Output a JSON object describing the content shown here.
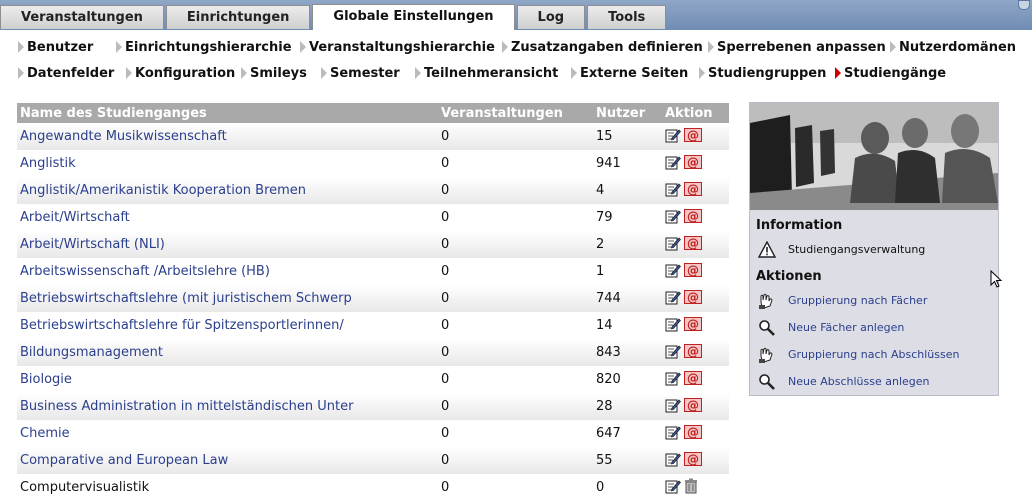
{
  "tabs": [
    {
      "label": "Veranstaltungen",
      "active": false
    },
    {
      "label": "Einrichtungen",
      "active": false
    },
    {
      "label": "Globale Einstellungen",
      "active": true
    },
    {
      "label": "Log",
      "active": false
    },
    {
      "label": "Tools",
      "active": false
    }
  ],
  "subnav": {
    "row1": [
      "Benutzer",
      "Einrichtungshierarchie",
      "Veranstaltungshierarchie",
      "Zusatzangaben definieren",
      "Sperrebenen anpassen",
      "Nutzerdomänen"
    ],
    "row2": [
      "Datenfelder",
      "Konfiguration",
      "Smileys",
      "Semester",
      "Teilnehmeransicht",
      "Externe Seiten",
      "Studiengruppen",
      "Studiengänge"
    ],
    "active": "Studiengänge"
  },
  "table": {
    "headers": {
      "name": "Name des Studienganges",
      "events": "Veranstaltungen",
      "users": "Nutzer",
      "action": "Aktion"
    },
    "rows": [
      {
        "name": "Angewandte Musikwissenschaft",
        "events": "0",
        "users": "15",
        "deletable": false
      },
      {
        "name": "Anglistik",
        "events": "0",
        "users": "941",
        "deletable": false
      },
      {
        "name": "Anglistik/Amerikanistik Kooperation Bremen",
        "events": "0",
        "users": "4",
        "deletable": false
      },
      {
        "name": "Arbeit/Wirtschaft",
        "events": "0",
        "users": "79",
        "deletable": false
      },
      {
        "name": "Arbeit/Wirtschaft (NLI)",
        "events": "0",
        "users": "2",
        "deletable": false
      },
      {
        "name": "Arbeitswissenschaft /Arbeitslehre (HB)",
        "events": "0",
        "users": "1",
        "deletable": false
      },
      {
        "name": "Betriebswirtschaftslehre (mit juristischem Schwerp",
        "events": "0",
        "users": "744",
        "deletable": false
      },
      {
        "name": "Betriebswirtschaftslehre für Spitzensportlerinnen/",
        "events": "0",
        "users": "14",
        "deletable": false
      },
      {
        "name": "Bildungsmanagement",
        "events": "0",
        "users": "843",
        "deletable": false
      },
      {
        "name": "Biologie",
        "events": "0",
        "users": "820",
        "deletable": false
      },
      {
        "name": "Business Administration in mittelständischen Unter",
        "events": "0",
        "users": "28",
        "deletable": false
      },
      {
        "name": "Chemie",
        "events": "0",
        "users": "647",
        "deletable": false
      },
      {
        "name": "Comparative and European Law",
        "events": "0",
        "users": "55",
        "deletable": false
      },
      {
        "name": "Computervisualistik",
        "events": "0",
        "users": "0",
        "deletable": true
      }
    ]
  },
  "sidebar": {
    "info_heading": "Information",
    "info_text": "Studiengangsverwaltung",
    "actions_heading": "Aktionen",
    "actions": [
      {
        "label": "Gruppierung nach Fächer",
        "icon": "hand-pointer-icon"
      },
      {
        "label": "Neue Fächer anlegen",
        "icon": "magnifier-icon"
      },
      {
        "label": "Gruppierung nach Abschlüssen",
        "icon": "hand-pointer-icon"
      },
      {
        "label": "Neue Abschlüsse anlegen",
        "icon": "magnifier-icon"
      }
    ]
  },
  "colors": {
    "link": "#2b3f8c",
    "header_bg": "#a9a9a9",
    "sidebar_bg": "#dcdde5",
    "active_arrow": "#cc0000"
  }
}
